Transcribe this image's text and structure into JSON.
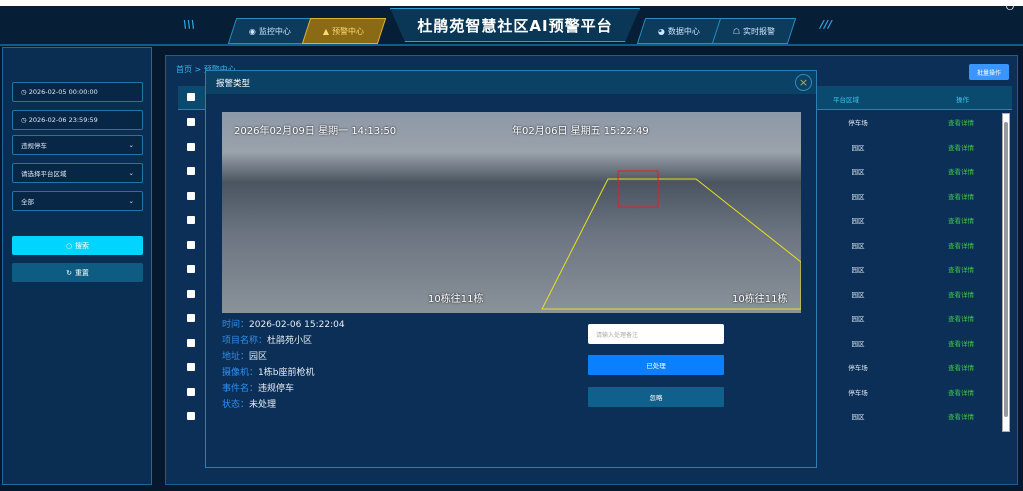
{
  "header": {
    "title": "杜鹃苑智慧社区AI预警平台",
    "tabs": [
      {
        "label": "监控中心",
        "icon": "camera-icon"
      },
      {
        "label": "预警中心",
        "icon": "alarm-icon",
        "active": true
      },
      {
        "label": "数据中心",
        "icon": "pie-chart-icon"
      },
      {
        "label": "实时报警",
        "icon": "broadcast-icon"
      }
    ],
    "accent": "#2ea0d8",
    "active_color": "#e0b030"
  },
  "sidebar": {
    "start_time": "2026-02-05 00:00:00",
    "end_time": "2026-02-06 23:59:59",
    "event_type": "违规停车",
    "area_placeholder": "请选择平台区域",
    "status": "全部",
    "search_label": "搜索",
    "reset_label": "重置"
  },
  "main": {
    "breadcrumb": "首页 > 预警中心",
    "batch_label": "批量操作",
    "columns": {
      "area": "平台区域",
      "action": "操作"
    },
    "rows": [
      {
        "area": "停车场",
        "action": "查看详情"
      },
      {
        "area": "园区",
        "action": "查看详情"
      },
      {
        "area": "园区",
        "action": "查看详情"
      },
      {
        "area": "园区",
        "action": "查看详情"
      },
      {
        "area": "园区",
        "action": "查看详情"
      },
      {
        "area": "园区",
        "action": "查看详情"
      },
      {
        "area": "园区",
        "action": "查看详情"
      },
      {
        "area": "园区",
        "action": "查看详情"
      },
      {
        "area": "园区",
        "action": "查看详情"
      },
      {
        "area": "园区",
        "action": "查看详情"
      },
      {
        "area": "停车场",
        "action": "查看详情"
      },
      {
        "area": "停车场",
        "action": "查看详情"
      },
      {
        "area": "园区",
        "action": "查看详情"
      }
    ]
  },
  "modal": {
    "title": "报警类型",
    "left_osd_time": "2026年02月09日   星期一   14:13:50",
    "right_osd_time": "年02月06日   星期五   15:22:49",
    "left_osd_label": "10栋往11栋",
    "right_osd_label": "10栋往11栋",
    "info": [
      {
        "k": "时间：",
        "v": "2026-02-06 15:22:04"
      },
      {
        "k": "项目名称：",
        "v": "杜鹃苑小区"
      },
      {
        "k": "地址：",
        "v": "园区"
      },
      {
        "k": "摄像机：",
        "v": "1栋b座前枪机"
      },
      {
        "k": "事件名：",
        "v": "违规停车"
      },
      {
        "k": "状态：",
        "v": "未处理"
      }
    ],
    "note_placeholder": "请输入处理备注",
    "done_label": "已处理",
    "ignore_label": "忽略"
  }
}
